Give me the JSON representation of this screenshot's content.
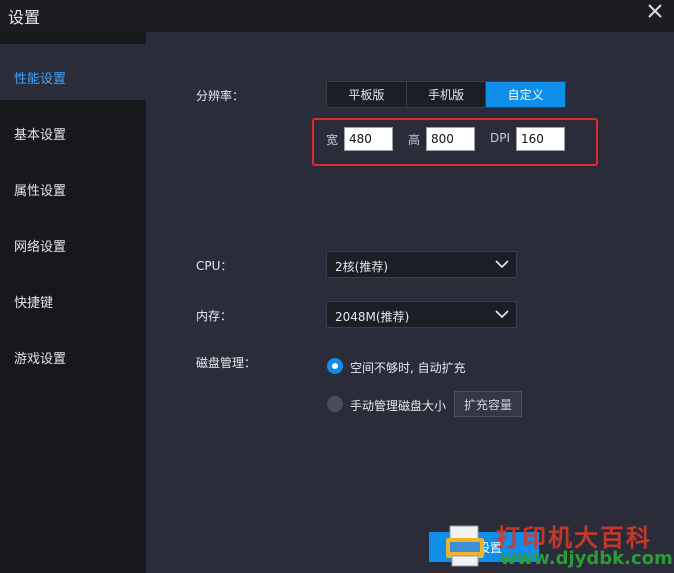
{
  "window": {
    "title": "设置"
  },
  "sidebar": {
    "items": [
      {
        "label": "性能设置",
        "active": true
      },
      {
        "label": "基本设置",
        "active": false
      },
      {
        "label": "属性设置",
        "active": false
      },
      {
        "label": "网络设置",
        "active": false
      },
      {
        "label": "快捷键",
        "active": false
      },
      {
        "label": "游戏设置",
        "active": false
      }
    ]
  },
  "performance": {
    "resolution_label": "分辨率：",
    "resolution_options": [
      "平板版",
      "手机版",
      "自定义"
    ],
    "resolution_selected": "自定义",
    "width_label": "宽",
    "width_value": "480",
    "height_label": "高",
    "height_value": "800",
    "dpi_label": "DPI",
    "dpi_value": "160",
    "cpu_label": "CPU：",
    "cpu_value": "2核(推荐)",
    "memory_label": "内存：",
    "memory_value": "2048M(推荐)",
    "disk_label": "磁盘管理：",
    "disk_option_auto": "空间不够时, 自动扩充",
    "disk_option_manual": "手动管理磁盘大小",
    "disk_selected": "auto",
    "expand_button": "扩充容量",
    "save_button": "存设置"
  },
  "watermark": {
    "text": "打印机大百科",
    "url": "www.djydbk.com"
  },
  "colors": {
    "accent": "#0e8ee8",
    "highlight_box": "#e0292b",
    "panel": "#2a2d39",
    "sidebar": "#17181c"
  }
}
